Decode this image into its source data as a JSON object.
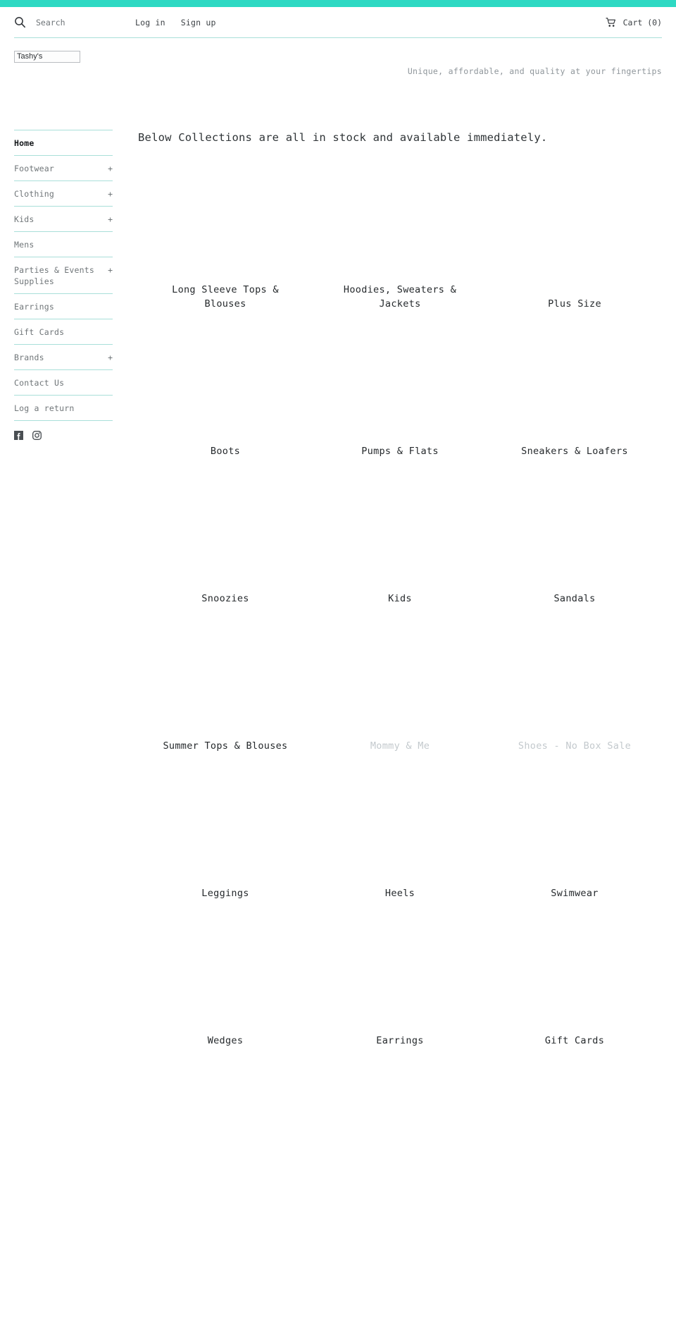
{
  "theme": {
    "accent": "#2ed9c3",
    "divider": "#a9dfd9",
    "text": "#3d4246",
    "muted_text": "#c3c9cd"
  },
  "header": {
    "search": {
      "icon": "search-icon",
      "placeholder": "Search",
      "value": ""
    },
    "log_in": "Log in",
    "sign_up": "Sign up",
    "cart": {
      "icon": "cart-icon",
      "label": "Cart (0)"
    }
  },
  "brand": {
    "logo_alt": "Tashy's",
    "tagline": "Unique, affordable, and quality at your fingertips"
  },
  "sidebar": {
    "items": [
      {
        "label": "Home",
        "expandable": false,
        "expander": "",
        "active": true
      },
      {
        "label": "Footwear",
        "expandable": true,
        "expander": "+",
        "active": false
      },
      {
        "label": "Clothing",
        "expandable": true,
        "expander": "+",
        "active": false
      },
      {
        "label": "Kids",
        "expandable": true,
        "expander": "+",
        "active": false
      },
      {
        "label": "Mens",
        "expandable": false,
        "expander": "",
        "active": false
      },
      {
        "label": "Parties & Events Supplies",
        "expandable": true,
        "expander": "+",
        "active": false
      },
      {
        "label": "Earrings",
        "expandable": false,
        "expander": "",
        "active": false
      },
      {
        "label": "Gift Cards",
        "expandable": false,
        "expander": "",
        "active": false
      },
      {
        "label": "Brands",
        "expandable": true,
        "expander": "+",
        "active": false
      },
      {
        "label": "Contact Us",
        "expandable": false,
        "expander": "",
        "active": false
      },
      {
        "label": "Log a return",
        "expandable": false,
        "expander": "",
        "active": false
      }
    ],
    "social": [
      {
        "name": "facebook-icon"
      },
      {
        "name": "instagram-icon"
      }
    ]
  },
  "main": {
    "heading": "Below Collections are all in stock and available immediately.",
    "collections": [
      {
        "title": "Long Sleeve Tops & Blouses",
        "muted": false
      },
      {
        "title": "Hoodies, Sweaters & Jackets",
        "muted": false
      },
      {
        "title": "Plus Size",
        "muted": false
      },
      {
        "title": "Boots",
        "muted": false
      },
      {
        "title": "Pumps & Flats",
        "muted": false
      },
      {
        "title": "Sneakers & Loafers",
        "muted": false
      },
      {
        "title": "Snoozies",
        "muted": false
      },
      {
        "title": "Kids",
        "muted": false
      },
      {
        "title": "Sandals",
        "muted": false
      },
      {
        "title": "Summer Tops & Blouses",
        "muted": false
      },
      {
        "title": "Mommy & Me",
        "muted": true
      },
      {
        "title": "Shoes - No Box Sale",
        "muted": true
      },
      {
        "title": "Leggings",
        "muted": false
      },
      {
        "title": "Heels",
        "muted": false
      },
      {
        "title": "Swimwear",
        "muted": false
      },
      {
        "title": "Wedges",
        "muted": false
      },
      {
        "title": "Earrings",
        "muted": false
      },
      {
        "title": "Gift Cards",
        "muted": false
      }
    ]
  }
}
